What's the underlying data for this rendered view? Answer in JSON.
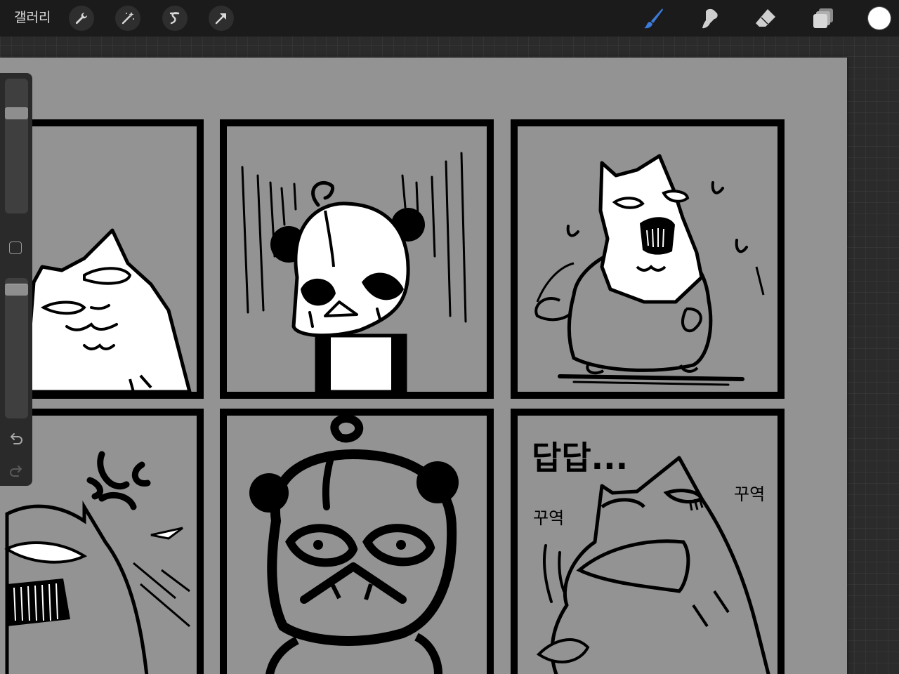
{
  "topbar": {
    "gallery_label": "갤러리",
    "left_tools": [
      "wrench-icon",
      "magic-wand-icon",
      "selection-icon",
      "transform-arrow-icon"
    ],
    "right_tools": [
      "brush-icon",
      "smudge-icon",
      "eraser-icon",
      "layers-icon"
    ],
    "active_tool": "brush",
    "active_color": "#ffffff",
    "accent_color": "#3a7bdc"
  },
  "sidebar": {
    "brush_size_level": 0.9,
    "opacity_level": 0.0,
    "icons": [
      "modify-square-icon",
      "undo-icon",
      "redo-icon"
    ]
  },
  "canvas": {
    "background": "#939393",
    "comic_text": {
      "dapdap": "답답...",
      "kkuyeok_left": "꾸역",
      "kkuyeok_right": "꾸역"
    }
  }
}
